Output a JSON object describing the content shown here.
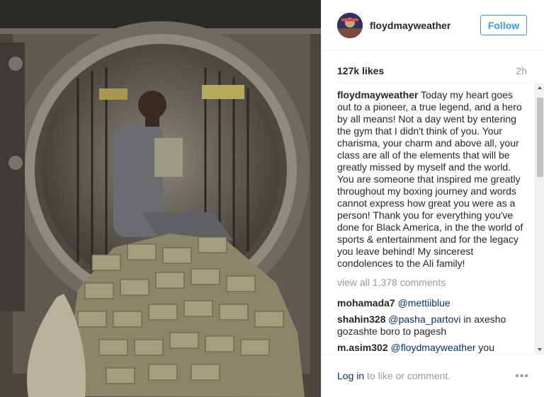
{
  "post": {
    "username": "floydmayweather",
    "follow_label": "Follow",
    "likes": "127k likes",
    "age": "2h",
    "caption_user": "floydmayweather",
    "caption_text": "Today my heart goes out to a pioneer, a true legend, and a hero by all means! Not a day went by entering the gym that I didn't think of you. Your charisma, your charm and above all, your class are all of the elements that will be greatly missed by myself and the world. You are someone that inspired me greatly throughout my boxing journey and words cannot express how great you were as a person! Thank you for everything you've done for Black America, in the the world of sports & entertainment and for the legacy you leave behind! My sincerest condolences to the Ali family!",
    "view_all": "view all 1,378 comments",
    "comments": [
      {
        "user": "mohamada7",
        "mention": "@mettiiblue",
        "text": ""
      },
      {
        "user": "shahin328",
        "mention": "@pasha_partovi",
        "text": " in axesho gozashte boro to pagesh"
      },
      {
        "user": "m.asim302",
        "mention": "@floydmayweather",
        "text": " you"
      }
    ],
    "login_link": "Log in",
    "login_text": " to like or comment.",
    "more_label": "•••"
  },
  "colors": {
    "accent": "#3897f0",
    "link": "#003569",
    "muted": "#999999"
  }
}
